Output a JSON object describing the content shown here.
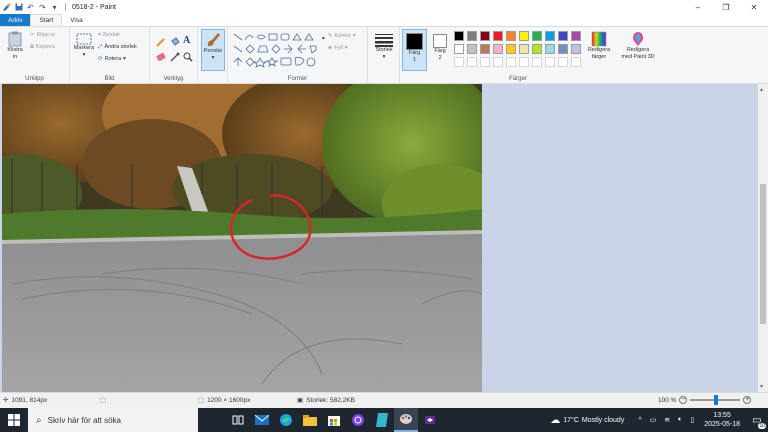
{
  "window": {
    "title": "0518-2 - Paint",
    "controls": {
      "minimize": "–",
      "maximize": "❐",
      "close": "✕"
    }
  },
  "tabs": [
    {
      "label": "Arkiv"
    },
    {
      "label": "Start"
    },
    {
      "label": "Visa"
    }
  ],
  "ribbon": {
    "clipboard": {
      "label": "Urklipp",
      "paste": "Klistra",
      "paste2": "in",
      "cut": "Klipp ut",
      "copy": "Kopiera"
    },
    "image": {
      "label": "Bild",
      "select": "Markera",
      "crop": "Beskär",
      "resize": "Ändra storlek",
      "rotate": "Rotera"
    },
    "tools": {
      "label": "Verktyg"
    },
    "brushes": {
      "label": "Penslar"
    },
    "shapes": {
      "label": "Former",
      "outline": "Kontur",
      "fill": "Fyll"
    },
    "size": {
      "label": "Storlek"
    },
    "color1": {
      "label": "Färg",
      "num": "1"
    },
    "color2": {
      "label": "Färg",
      "num": "2"
    },
    "colors": {
      "label": "Färger",
      "palette": [
        "#000000",
        "#7f7f7f",
        "#880015",
        "#ed1c24",
        "#ff7f27",
        "#fff200",
        "#22b14c",
        "#00a2e8",
        "#3f48cc",
        "#a349a4",
        "#ffffff",
        "#c3c3c3",
        "#b97a57",
        "#ffaec9",
        "#ffc90e",
        "#efe4b0",
        "#b5e61d",
        "#99d9ea",
        "#7092be",
        "#c8bfe7"
      ]
    },
    "edit_colors": {
      "line1": "Redigera",
      "line2": "färger"
    },
    "paint3d": {
      "line1": "Redigera",
      "line2": "med Paint 3D"
    }
  },
  "status": {
    "cursor": "1091, 814px",
    "dimensions": "1200 × 1600px",
    "size": "Storlek: 582,2KB",
    "zoom": "100 %"
  },
  "taskbar": {
    "search_placeholder": "Skriv här för att söka",
    "weather_temp": "17°C",
    "weather_text": "Mostly cloudy",
    "time": "13:55",
    "date": "2025-05-18",
    "notifications": "10"
  }
}
